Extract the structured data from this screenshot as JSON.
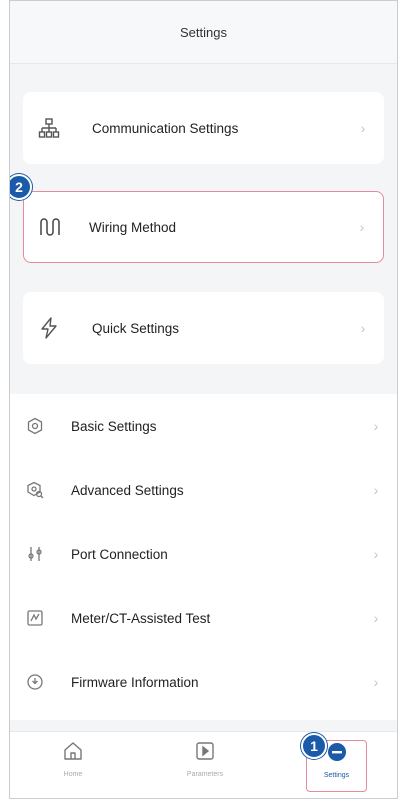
{
  "header": {
    "title": "Settings"
  },
  "cards": [
    {
      "label": "Communication Settings",
      "icon": "network-icon"
    },
    {
      "label": "Wiring Method",
      "icon": "wiring-icon"
    },
    {
      "label": "Quick Settings",
      "icon": "lightning-icon"
    }
  ],
  "list": [
    {
      "label": "Basic Settings",
      "icon": "basic-settings-icon"
    },
    {
      "label": "Advanced Settings",
      "icon": "advanced-settings-icon"
    },
    {
      "label": "Port Connection",
      "icon": "port-icon"
    },
    {
      "label": "Meter/CT-Assisted Test",
      "icon": "meter-icon"
    },
    {
      "label": "Firmware Information",
      "icon": "firmware-icon"
    }
  ],
  "tabs": [
    {
      "label": "Home",
      "icon": "home-icon"
    },
    {
      "label": "Parameters",
      "icon": "parameters-icon"
    },
    {
      "label": "Settings",
      "icon": "settings-icon"
    }
  ],
  "markers": {
    "one": "1",
    "two": "2"
  },
  "colors": {
    "accent": "#1a5aa8",
    "highlight": "#e58a9a"
  }
}
